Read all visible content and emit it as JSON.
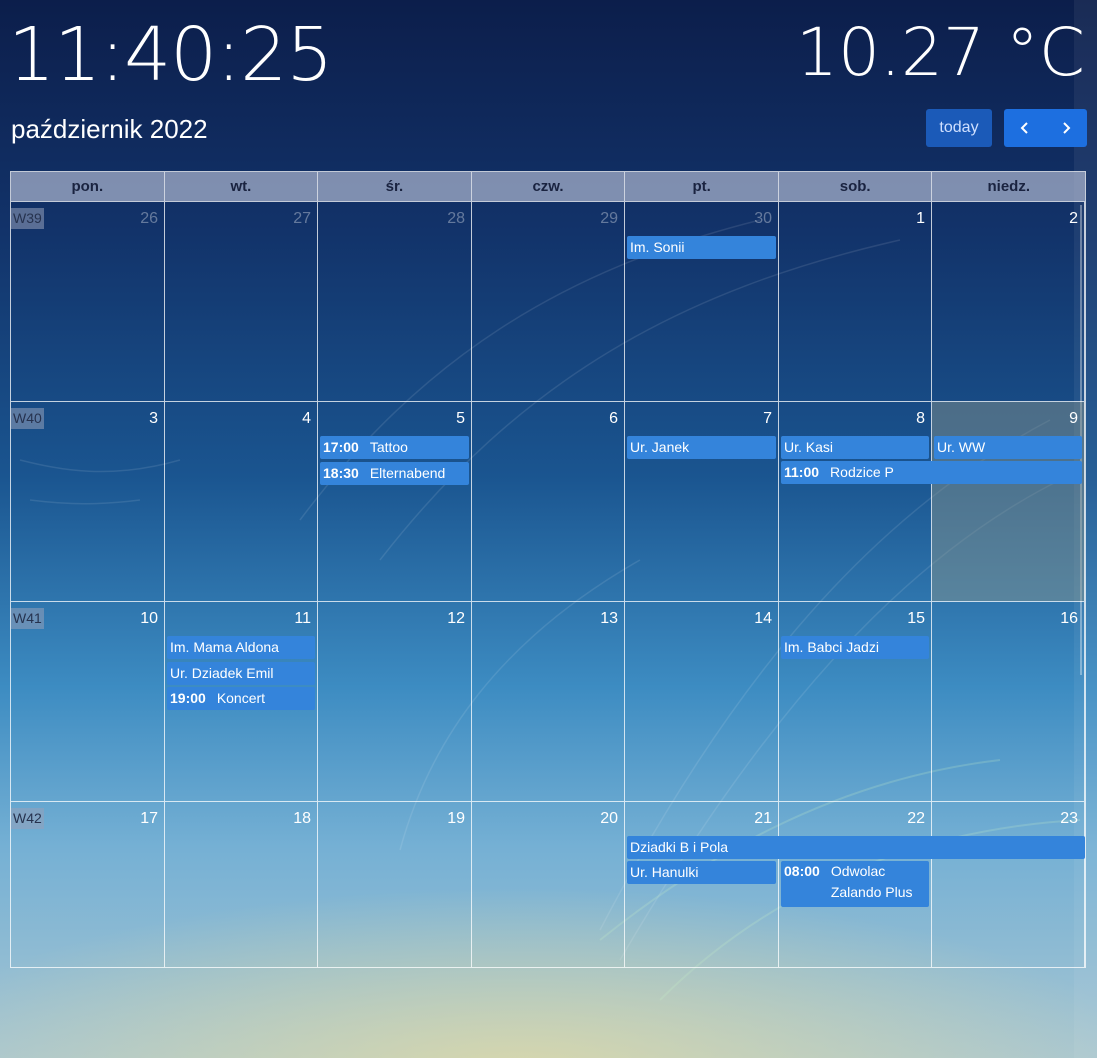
{
  "header": {
    "clock": "11:40:25",
    "temperature": "10.27 °C",
    "month_title": "październik 2022",
    "today_label": "today",
    "prev_icon": "chevron-left-icon",
    "next_icon": "chevron-right-icon"
  },
  "colors": {
    "button_today": "#1b5ab8",
    "button_nav": "#1d6fe0",
    "event": "#3484db",
    "header_row": "#aab4cd"
  },
  "calendar": {
    "weekdays": [
      "pon.",
      "wt.",
      "śr.",
      "czw.",
      "pt.",
      "sob.",
      "niedz."
    ],
    "weeks": [
      {
        "label": "W39",
        "days": [
          "26",
          "27",
          "28",
          "29",
          "30",
          "1",
          "2"
        ],
        "events": [
          {
            "time": "",
            "title": "Im. Sonii"
          }
        ]
      },
      {
        "label": "W40",
        "days": [
          "3",
          "4",
          "5",
          "6",
          "7",
          "8",
          "9"
        ],
        "events": [
          {
            "time": "17:00",
            "title": "Tattoo"
          },
          {
            "time": "18:30",
            "title": "Elternabend"
          },
          {
            "time": "",
            "title": "Ur. Janek"
          },
          {
            "time": "",
            "title": "Ur. Kasi"
          },
          {
            "time": "11:00",
            "title": "Rodzice P"
          },
          {
            "time": "",
            "title": "Ur. WW"
          }
        ]
      },
      {
        "label": "W41",
        "days": [
          "10",
          "11",
          "12",
          "13",
          "14",
          "15",
          "16"
        ],
        "events": [
          {
            "time": "",
            "title": "Im. Mama Aldona"
          },
          {
            "time": "",
            "title": "Ur. Dziadek Emil"
          },
          {
            "time": "19:00",
            "title": "Koncert"
          },
          {
            "time": "",
            "title": "Im. Babci Jadzi"
          }
        ]
      },
      {
        "label": "W42",
        "days": [
          "17",
          "18",
          "19",
          "20",
          "21",
          "22",
          "23"
        ],
        "events": [
          {
            "time": "",
            "title": "Dziadki B i Pola"
          },
          {
            "time": "",
            "title": "Ur. Hanulki"
          },
          {
            "time": "08:00",
            "title": "Odwolac Zalando Plus"
          }
        ]
      }
    ]
  }
}
